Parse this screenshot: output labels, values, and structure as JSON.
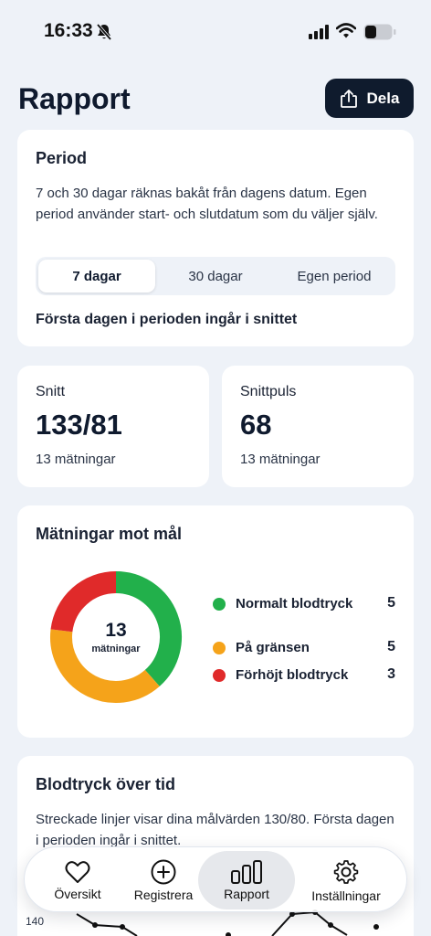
{
  "status": {
    "time": "16:33",
    "icons": [
      "bell-off-icon",
      "cellular-signal-icon",
      "wifi-icon",
      "battery-icon"
    ]
  },
  "header": {
    "title": "Rapport",
    "share_label": "Dela",
    "share_icon": "share-icon"
  },
  "period": {
    "title": "Period",
    "description": "7 och 30 dagar räknas bakåt från dagens datum. Egen period använder start- och slutdatum som du väljer själv.",
    "options": [
      "7 dagar",
      "30 dagar",
      "Egen period"
    ],
    "selected": "7 dagar",
    "note": "Första dagen i perioden ingår i snittet"
  },
  "stats": {
    "average": {
      "label": "Snitt",
      "value": "133/81",
      "sub": "13 mätningar"
    },
    "pulse": {
      "label": "Snittpuls",
      "value": "68",
      "sub": "13 mätningar"
    }
  },
  "goals": {
    "title": "Mätningar mot mål",
    "total": "13",
    "total_label": "mätningar",
    "items": [
      {
        "label": "Normalt blodtryck",
        "count": 5,
        "color": "#22b04b"
      },
      {
        "label": "På gränsen",
        "count": 5,
        "color": "#f5a31a"
      },
      {
        "label": "Förhöjt blodtryck",
        "count": 3,
        "color": "#e02a2a"
      }
    ]
  },
  "chart_data": {
    "type": "pie",
    "categories": [
      "Normalt blodtryck",
      "På gränsen",
      "Förhöjt blodtryck"
    ],
    "values": [
      5,
      5,
      3
    ],
    "colors": [
      "#22b04b",
      "#f5a31a",
      "#e02a2a"
    ]
  },
  "over_time": {
    "title": "Blodtryck över tid",
    "description": "Streckade linjer visar dina målvärden 130/80. Första dagen i perioden ingår i snittet.",
    "tick_label": "140"
  },
  "tabs": [
    {
      "label": "Översikt",
      "icon": "heart-icon"
    },
    {
      "label": "Registrera",
      "icon": "plus-circle-icon"
    },
    {
      "label": "Rapport",
      "icon": "bar-chart-icon",
      "active": true
    },
    {
      "label": "Inställningar",
      "icon": "gear-icon"
    }
  ],
  "colors": {
    "background": "#eef2f8",
    "primary_dark": "#0f1b2d",
    "card": "#ffffff"
  }
}
